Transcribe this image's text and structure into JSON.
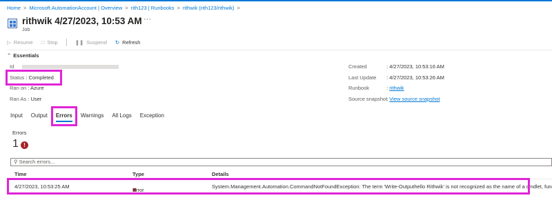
{
  "breadcrumb": [
    "Home",
    "Microsoft.AutomationAccount | Overview",
    "rith123 | Runbooks",
    "rithwik (rith123/rithwik)"
  ],
  "header": {
    "title": "rithwik 4/27/2023, 10:53 AM",
    "more": "···",
    "subtitle": "Job"
  },
  "toolbar": {
    "resume": "Resume",
    "stop": "Stop",
    "suspend": "Suspend",
    "refresh": "Refresh"
  },
  "essentials": {
    "title": "Essentials",
    "left": [
      {
        "label": "Id",
        "value": ""
      },
      {
        "label": "Status",
        "value": "Completed"
      },
      {
        "label": "Ran on",
        "value": "Azure"
      },
      {
        "label": "Ran As",
        "value": "User"
      }
    ],
    "right": [
      {
        "label": "Created",
        "value": "4/27/2023, 10:53:16 AM"
      },
      {
        "label": "Last Update",
        "value": "4/27/2023, 10:53:26 AM"
      },
      {
        "label": "Runbook",
        "value": "rithwik"
      },
      {
        "label": "Source snapshot",
        "value": "View source snapshot"
      }
    ],
    "colon": ":"
  },
  "tabs": [
    "Input",
    "Output",
    "Errors",
    "Warnings",
    "All Logs",
    "Exception"
  ],
  "errors": {
    "label": "Errors",
    "count": "1",
    "badge": "!"
  },
  "search": {
    "placeholder": "Search errors..."
  },
  "table": {
    "headers": [
      "Time",
      "Type",
      "Details"
    ],
    "rows": [
      {
        "time": "4/27/2023, 10:53:25 AM",
        "type": "Error",
        "details": "System.Management.Automation.CommandNotFoundException: The term 'Write-Outputhello Rithwik' is not recognized as the name of a cmdlet, function, script"
      }
    ]
  },
  "colors": {
    "accent": "#0078d4",
    "highlight": "#e024d6",
    "error": "#a4262c"
  }
}
